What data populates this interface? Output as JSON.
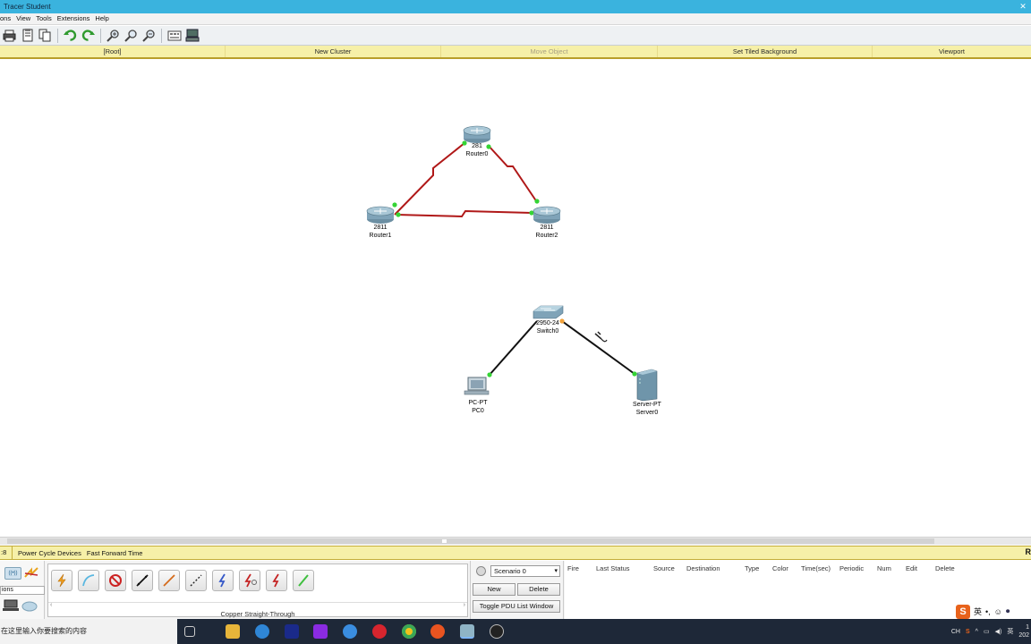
{
  "window": {
    "title": "Tracer Student"
  },
  "menu": [
    "ons",
    "View",
    "Tools",
    "Extensions",
    "Help"
  ],
  "toolbar": {
    "icons": [
      "print-icon",
      "activity-wizard-icon",
      "copy-icon",
      "undo-icon",
      "redo-icon",
      "zoom-in-icon",
      "zoom-reset-icon",
      "zoom-out-icon",
      "palette-icon",
      "custom-device-icon"
    ]
  },
  "nav": {
    "root": "[Root]",
    "new_cluster": "New Cluster",
    "move_object": "Move Object",
    "set_tiled_background": "Set Tiled Background",
    "viewport": "Viewport"
  },
  "topology": {
    "devices": [
      {
        "id": "router0",
        "kind": "router",
        "model": "2811",
        "name": "Router0",
        "model_display": "281"
      },
      {
        "id": "router1",
        "kind": "router",
        "model": "2811",
        "name": "Router1"
      },
      {
        "id": "router2",
        "kind": "router",
        "model": "2811",
        "name": "Router2"
      },
      {
        "id": "switch0",
        "kind": "switch",
        "model": "2950-24",
        "name": "Switch0"
      },
      {
        "id": "pc0",
        "kind": "pc",
        "model": "PC-PT",
        "name": "PC0"
      },
      {
        "id": "server0",
        "kind": "server",
        "model": "Server-PT",
        "name": "Server0"
      }
    ],
    "links": [
      {
        "from": "router0",
        "to": "router1",
        "type": "serial",
        "color": "#b01818"
      },
      {
        "from": "router0",
        "to": "router2",
        "type": "serial",
        "color": "#b01818"
      },
      {
        "from": "router1",
        "to": "router2",
        "type": "serial",
        "color": "#b01818"
      },
      {
        "from": "switch0",
        "to": "pc0",
        "type": "copper-straight",
        "color": "#111111"
      },
      {
        "from": "switch0",
        "to": "server0",
        "type": "copper-straight",
        "color": "#111111"
      }
    ],
    "link_up_color": "#35d435"
  },
  "realtime": {
    "time": ":8",
    "power_cycle": "Power Cycle Devices",
    "fast_forward": "Fast Forward Time",
    "mode": "R"
  },
  "device_panel": {
    "category_label": "ions",
    "connections": [
      "automatic-connection",
      "console",
      "no-cable",
      "copper-straight-through",
      "copper-cross-over",
      "fiber",
      "phone",
      "coaxial",
      "serial-dce",
      "serial-dte",
      "octal"
    ],
    "selected_caption": "Copper Straight-Through"
  },
  "scenario": {
    "select_value": "Scenario 0",
    "new_label": "New",
    "delete_label": "Delete",
    "toggle_label": "Toggle PDU List Window"
  },
  "pdu_columns": [
    "Fire",
    "Last Status",
    "Source",
    "Destination",
    "Type",
    "Color",
    "Time(sec)",
    "Periodic",
    "Num",
    "Edit",
    "Delete"
  ],
  "taskbar": {
    "search_placeholder": "在这里输入你要搜索的内容",
    "apps": [
      "task-view",
      "file-explorer",
      "sogou-browser",
      "iqiyi",
      "intellij",
      "feishu",
      "netease-music",
      "chrome",
      "ubuntu",
      "packet-tracer",
      "obs"
    ],
    "tray_lang": "CH",
    "clock_time": "1",
    "clock_date": "202"
  },
  "ime": {
    "logo": "S",
    "lang": "英",
    "punct": "•,",
    "face": "☺",
    "mic": "🎤"
  }
}
